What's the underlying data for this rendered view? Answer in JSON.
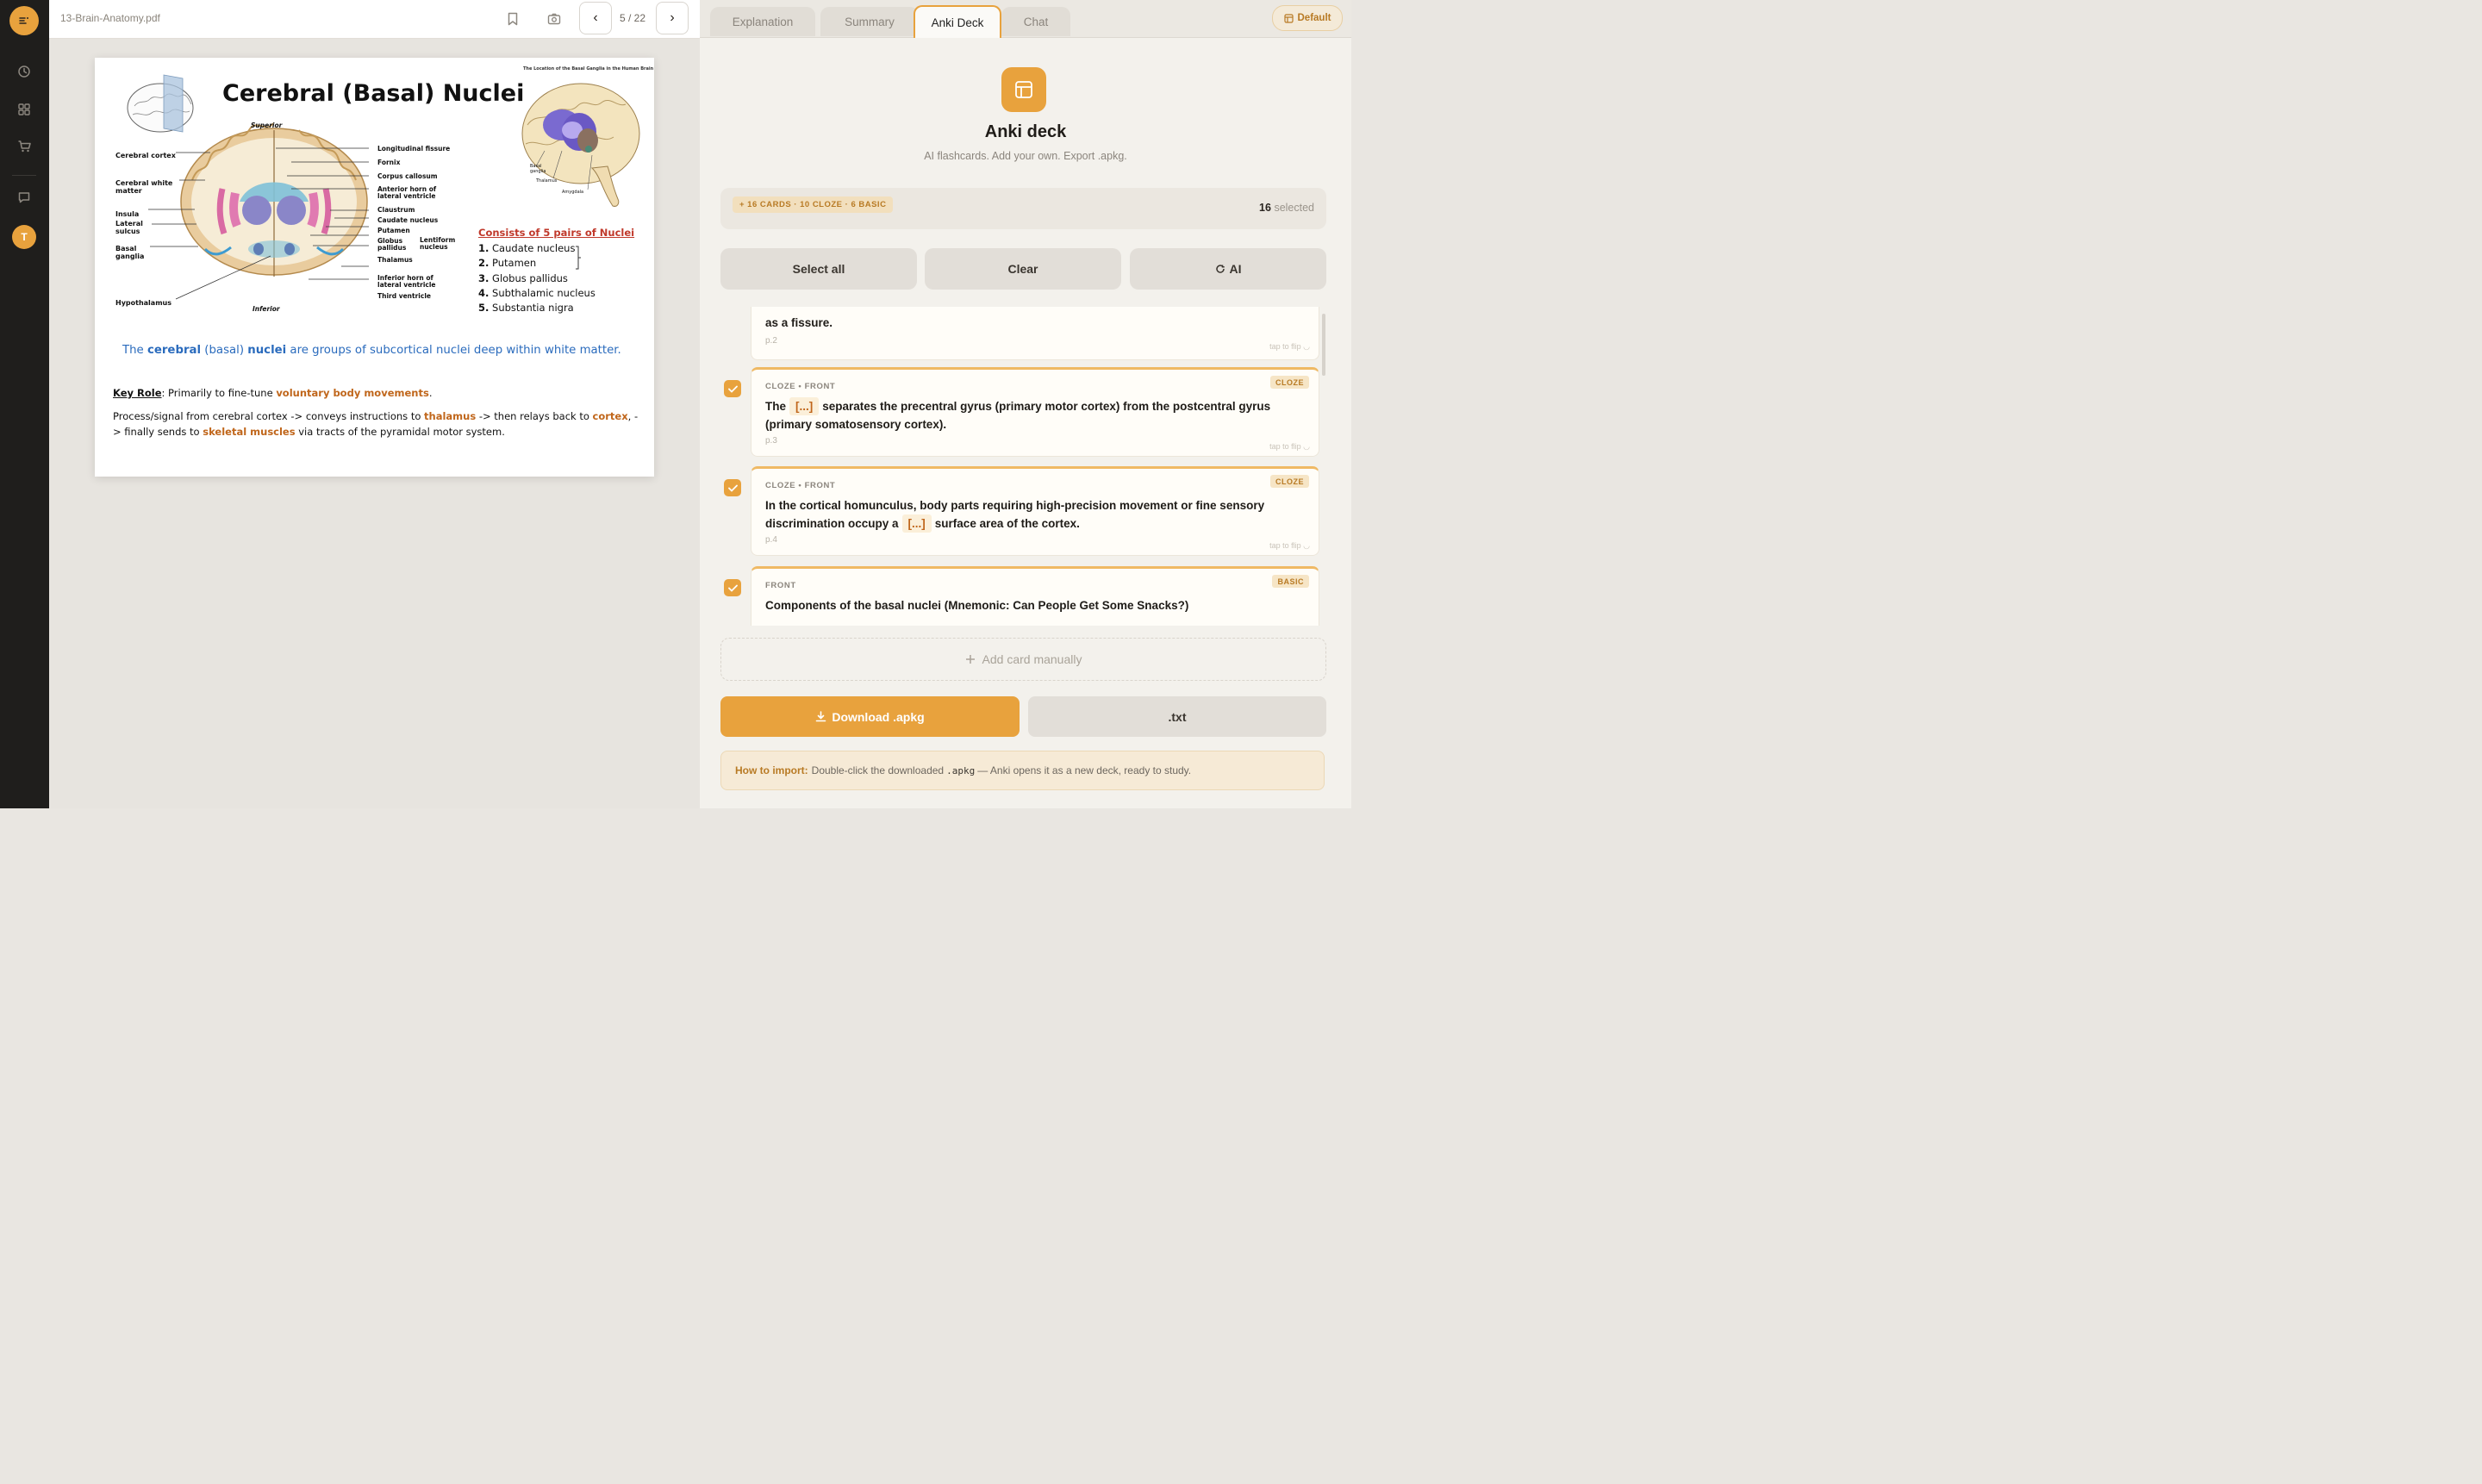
{
  "rail": {
    "avatar_initial": "T"
  },
  "viewer": {
    "filename": "13-Brain-Anatomy.pdf",
    "page_indicator": "5 / 22",
    "prev_glyph": "‹",
    "next_glyph": "›"
  },
  "slide": {
    "title": "Cerebral (Basal) Nuclei",
    "subtitle": "The Location of the Basal Ganglia in the Human Brain",
    "labels_left": [
      "Cerebral cortex",
      "Cerebral white matter",
      "Insula",
      "Lateral sulcus",
      "Basal ganglia",
      "Hypothalamus"
    ],
    "labels_right": [
      "Longitudinal fissure",
      "Fornix",
      "Corpus callosum",
      "Anterior horn of lateral ventricle",
      "Claustrum",
      "Caudate nucleus",
      "Putamen",
      "Globus pallidus",
      "Lentiform nucleus",
      "Thalamus",
      "Inferior horn of lateral ventricle",
      "Third ventricle"
    ],
    "superior": "Superior",
    "inferior": "Inferior",
    "inset_labels": [
      "Basal ganglia",
      "Thalamus",
      "Amygdala"
    ],
    "consists_title": "Consists of 5 pairs of Nuclei",
    "nuclei": [
      {
        "n": "1.",
        "name": "Caudate nucleus"
      },
      {
        "n": "2.",
        "name": "Putamen"
      },
      {
        "n": "3.",
        "name": "Globus pallidus"
      },
      {
        "n": "4.",
        "name": "Subthalamic nucleus"
      },
      {
        "n": "5.",
        "name": "Substantia nigra"
      }
    ],
    "definition": {
      "p1": "The ",
      "b1": "cerebral",
      "p2": " (basal) ",
      "b2": "nuclei",
      "p3": " are groups of subcortical nuclei deep within white matter."
    },
    "key_role": {
      "label": "Key Role",
      "text": ": Primarily to fine-tune ",
      "highlight": "voluntary body movements",
      "end": "."
    },
    "process": {
      "t1": "Process/signal from cerebral cortex -> conveys instructions to ",
      "h1": "thalamus",
      "t2": " -> then relays back to ",
      "h2": "cortex",
      "t3": ", -> finally sends to ",
      "h3": "skeletal muscles",
      "t4": " via tracts of the pyramidal motor system."
    }
  },
  "panel": {
    "tabs": [
      "Explanation",
      "Summary",
      "Anki Deck",
      "Chat"
    ],
    "active_tab": "Anki Deck",
    "default_label": "Default",
    "deck_title": "Anki deck",
    "deck_subtitle": "AI flashcards. Add your own. Export .apkg.",
    "stats_pill": "+ 16 CARDS · 10 CLOZE · 6 BASIC",
    "selected_count": "16",
    "selected_label": "selected",
    "actions": {
      "select_all": "Select all",
      "clear": "Clear",
      "ai": "AI"
    },
    "cards": [
      {
        "kind": "",
        "tag": "",
        "text_tail": "as a fissure.",
        "page": "p.2",
        "flip": "tap to flip ◡"
      },
      {
        "kind": "CLOZE • FRONT",
        "tag": "CLOZE",
        "pre": "The",
        "cloze": "[...]",
        "post": "separates the precentral gyrus (primary motor cortex) from the postcentral gyrus (primary somatosensory cortex).",
        "page": "p.3",
        "flip": "tap to flip ◡"
      },
      {
        "kind": "CLOZE • FRONT",
        "tag": "CLOZE",
        "pre": "In the cortical homunculus, body parts requiring high-precision movement or fine sensory discrimination occupy a",
        "cloze": "[...]",
        "post": "surface area of the cortex.",
        "page": "p.4",
        "flip": "tap to flip ◡"
      },
      {
        "kind": "FRONT",
        "tag": "BASIC",
        "text": "Components of the basal nuclei (Mnemonic: Can People Get Some Snacks?)"
      }
    ],
    "add_card": "Add card manually",
    "download": "Download .apkg",
    "txt": ".txt",
    "howto": {
      "label": "How to import:",
      "pre": "Double-click the downloaded",
      "code": ".apkg",
      "post": "— Anki opens it as a new deck, ready to study."
    }
  },
  "colors": {
    "accent": "#e8a23d",
    "rail": "#1f1e1c",
    "cloze_text": "#c0661b",
    "definition_blue": "#2a6bbd",
    "consists_red": "#c0392b"
  }
}
